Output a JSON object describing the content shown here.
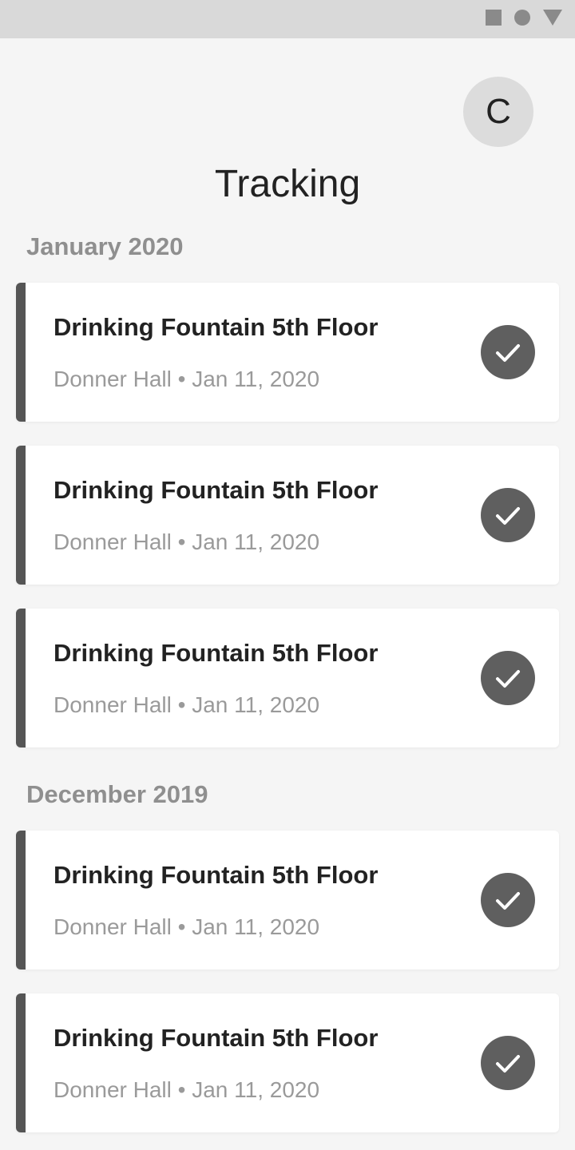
{
  "header": {
    "avatar_initial": "C",
    "title": "Tracking"
  },
  "icons": {
    "status": [
      "square-icon",
      "circle-icon",
      "triangle-icon"
    ],
    "check": "check-icon"
  },
  "colors": {
    "accent": "#555555",
    "check_bg": "#5f5f5f",
    "section_header": "#8f8f8f"
  },
  "sections": [
    {
      "label": "January 2020",
      "items": [
        {
          "title": "Drinking Fountain 5th Floor",
          "subtitle": "Donner Hall • Jan 11, 2020"
        },
        {
          "title": "Drinking Fountain 5th Floor",
          "subtitle": "Donner Hall • Jan 11, 2020"
        },
        {
          "title": "Drinking Fountain 5th Floor",
          "subtitle": "Donner Hall • Jan 11, 2020"
        }
      ]
    },
    {
      "label": "December 2019",
      "items": [
        {
          "title": "Drinking Fountain 5th Floor",
          "subtitle": "Donner Hall • Jan 11, 2020"
        },
        {
          "title": "Drinking Fountain 5th Floor",
          "subtitle": "Donner Hall • Jan 11, 2020"
        }
      ]
    }
  ]
}
